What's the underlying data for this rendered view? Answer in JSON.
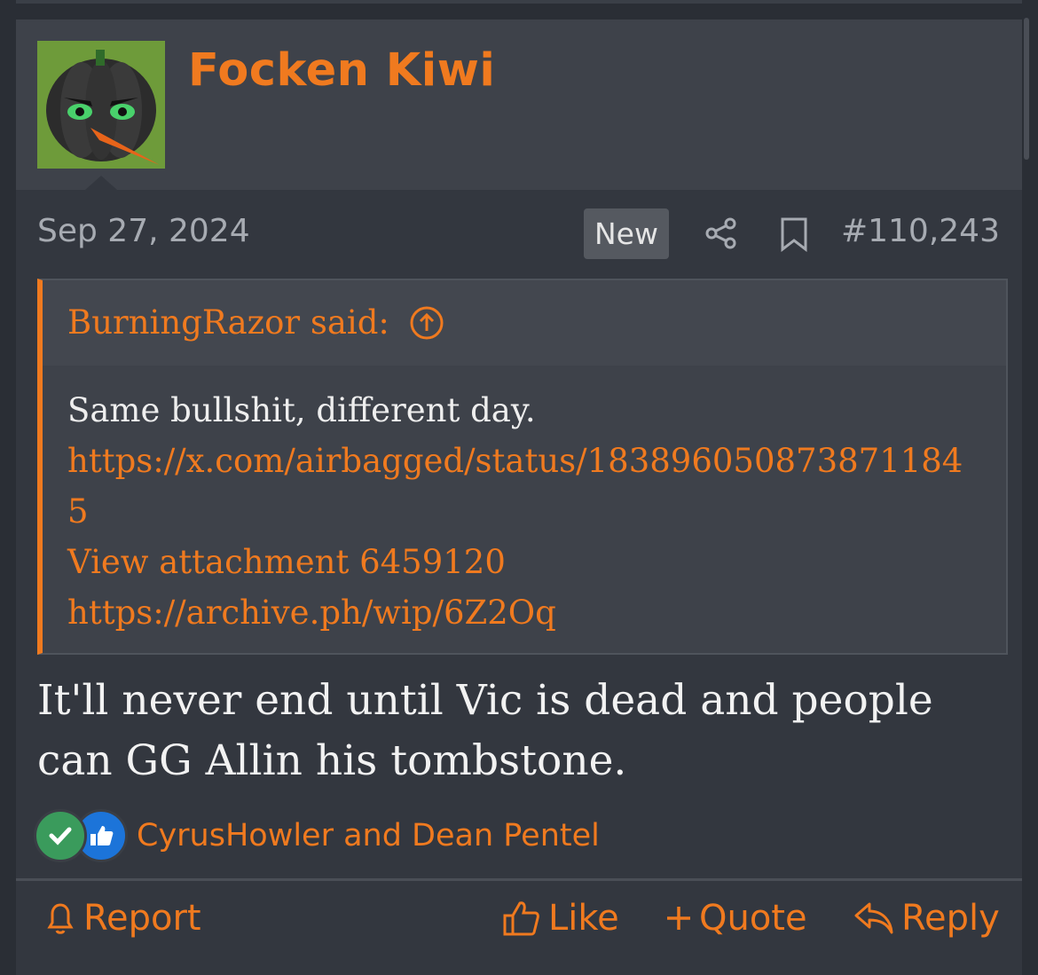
{
  "post": {
    "username": "Focken Kiwi",
    "date": "Sep 27, 2024",
    "new_badge": "New",
    "post_number": "#110,243",
    "quote": {
      "attribution": "BurningRazor said:",
      "text": "Same bullshit, different day.",
      "link1": "https://x.com/airbagged/status/1838960508738711845",
      "attachment": "View attachment 6459120",
      "link2": "https://archive.ph/wip/6Z2Oq"
    },
    "message": "It'll never end until Vic is dead and people can GG Allin his tombstone.",
    "reactions": {
      "names": "CyrusHowler and Dean Pentel"
    },
    "actions": {
      "report": "Report",
      "like": "Like",
      "quote": "Quote",
      "reply": "Reply"
    }
  },
  "colors": {
    "accent": "#f07a1f",
    "background": "#33373f",
    "header": "#3e424a"
  },
  "icons": [
    "share-icon",
    "bookmark-icon",
    "arrow-up-circle-icon",
    "check-reaction-icon",
    "like-reaction-icon",
    "bell-icon",
    "thumbs-up-icon",
    "plus-icon",
    "reply-icon"
  ]
}
